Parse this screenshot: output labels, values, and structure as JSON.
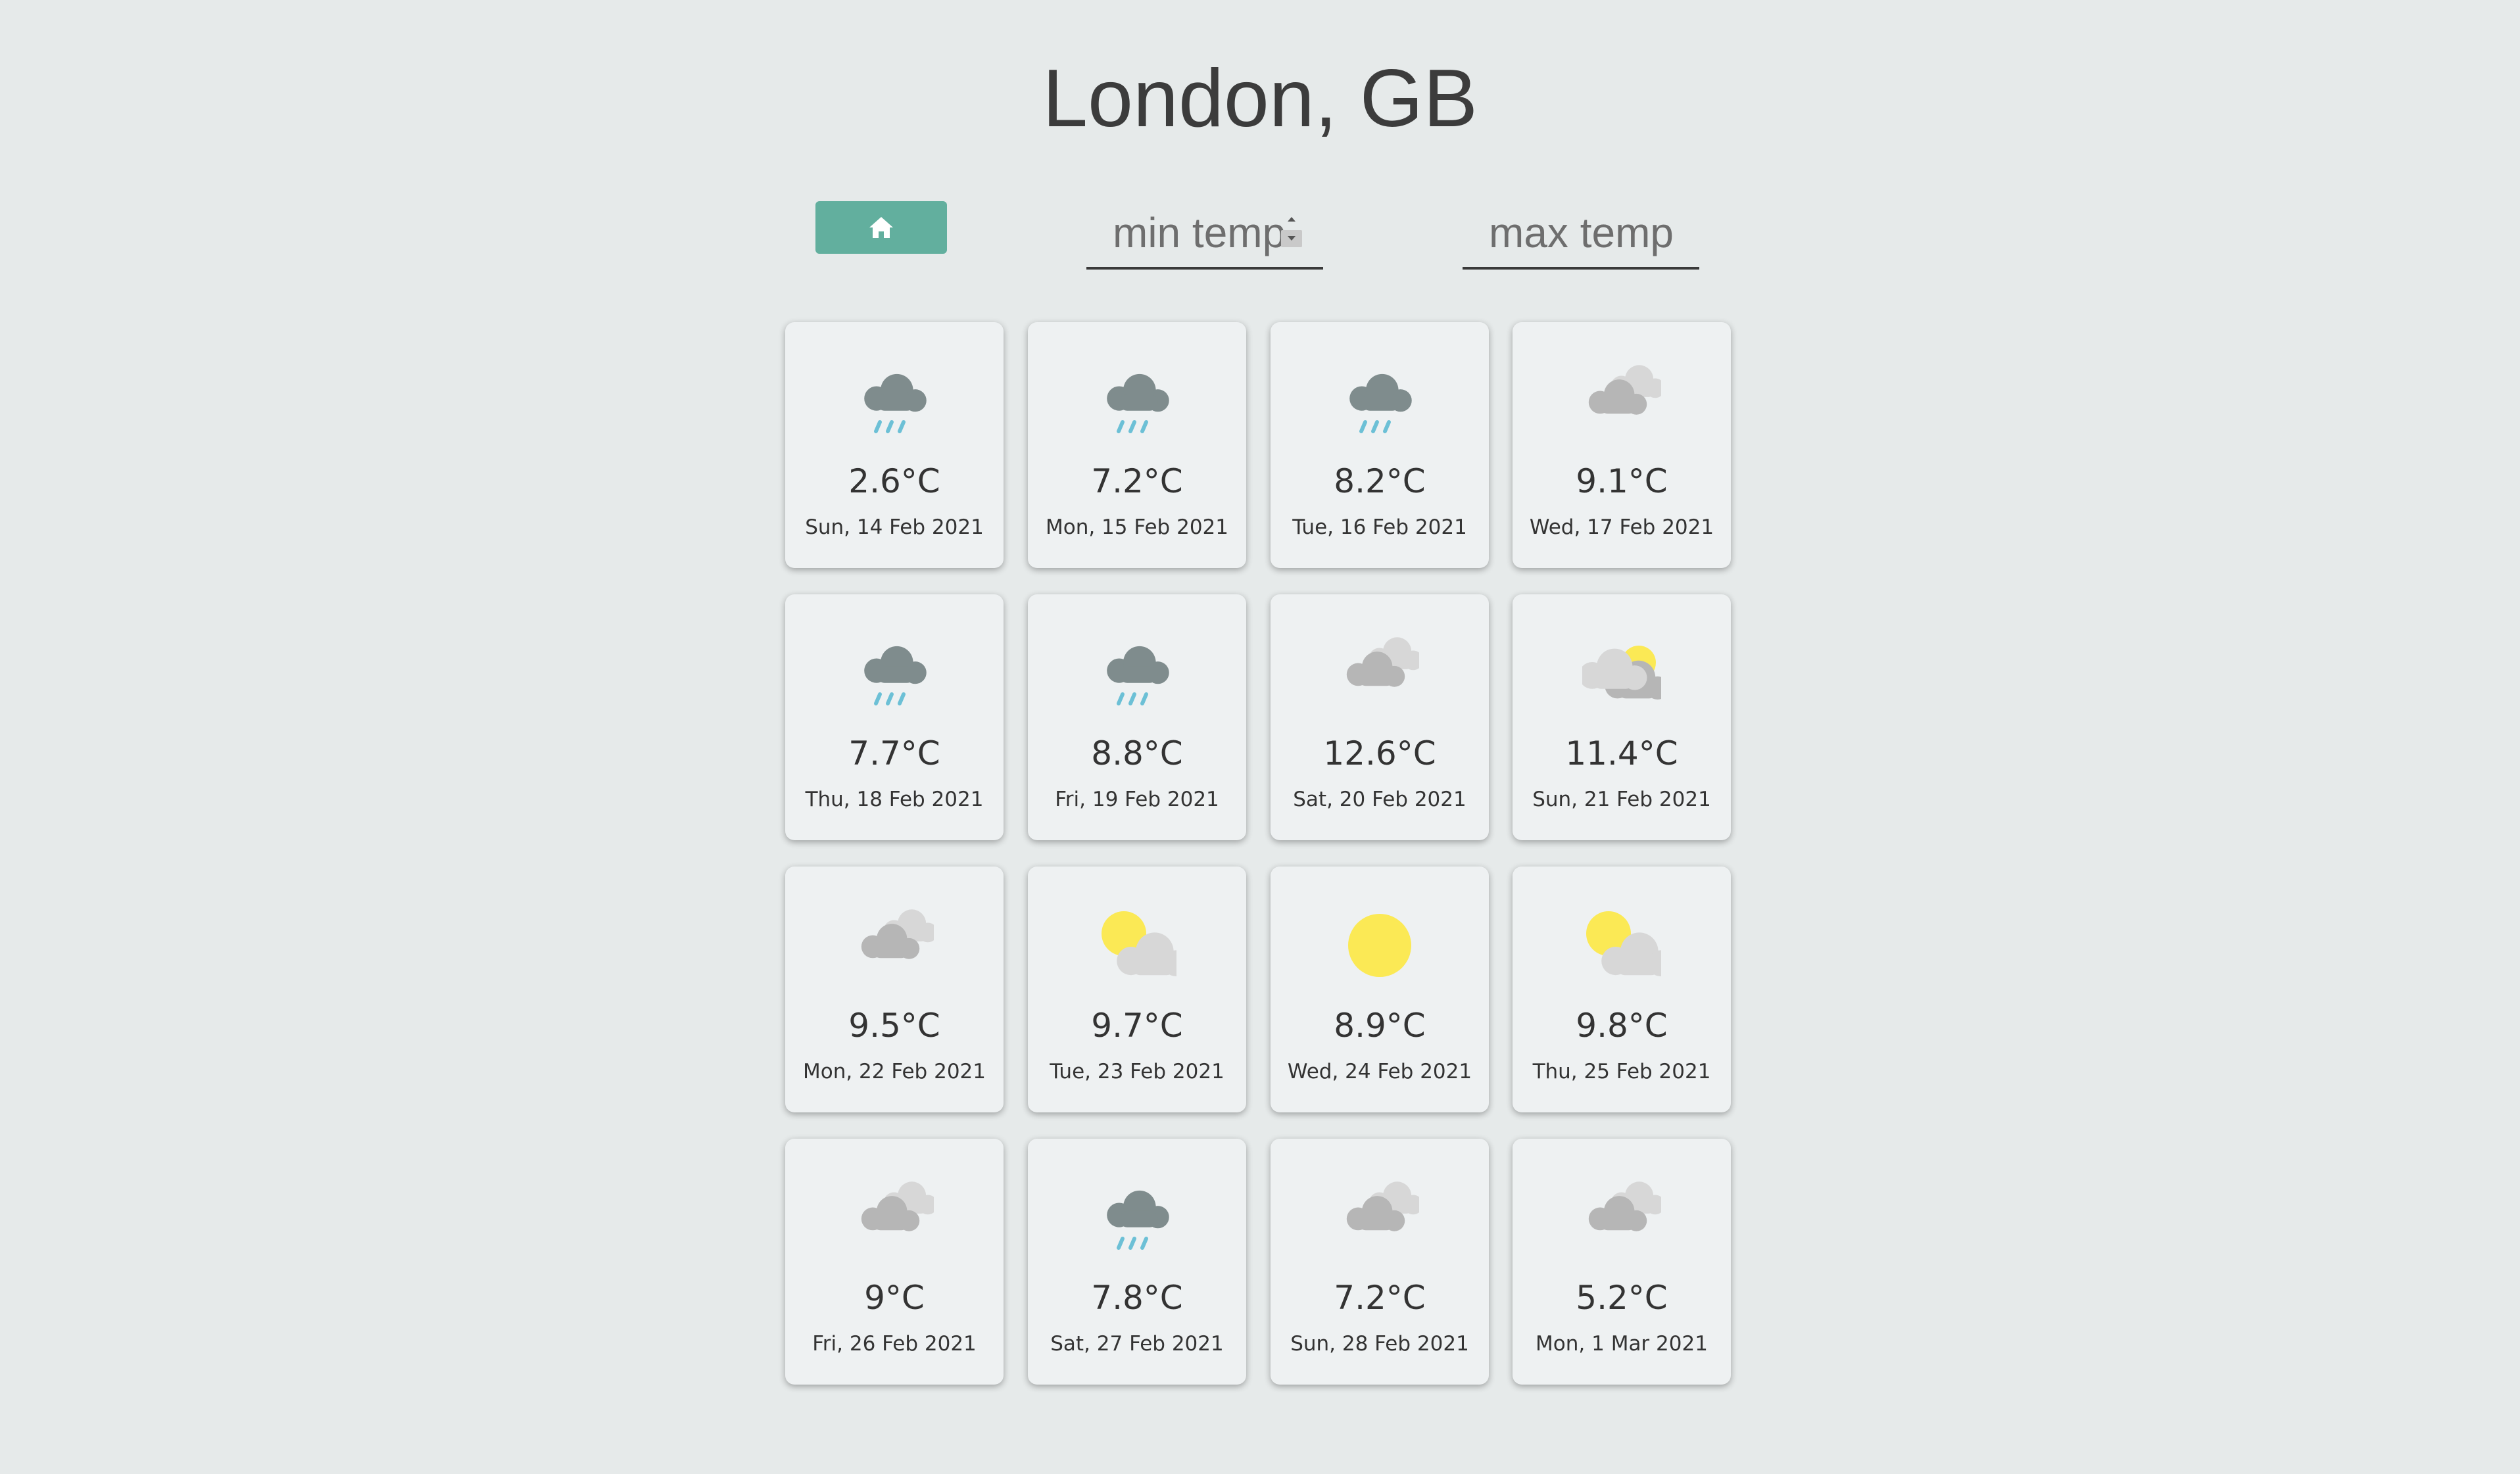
{
  "header": {
    "title": "London, GB"
  },
  "controls": {
    "min_placeholder": "min temp",
    "max_placeholder": "max temp"
  },
  "colors": {
    "home_button": "#62af9e",
    "page_background": "#e6eaea",
    "card_background": "#eef1f2",
    "rain_cloud": "#7f8c8d",
    "rain_drops": "#6cc0d6",
    "cloud_light": "#d7d7d7",
    "cloud_mid": "#b6b6b6",
    "sun": "#fbe955"
  },
  "forecast": [
    {
      "icon": "rain-icon",
      "temp": "2.6°C",
      "date": "Sun, 14 Feb 2021"
    },
    {
      "icon": "rain-icon",
      "temp": "7.2°C",
      "date": "Mon, 15 Feb 2021"
    },
    {
      "icon": "rain-icon",
      "temp": "8.2°C",
      "date": "Tue, 16 Feb 2021"
    },
    {
      "icon": "cloudy-icon",
      "temp": "9.1°C",
      "date": "Wed, 17 Feb 2021"
    },
    {
      "icon": "rain-icon",
      "temp": "7.7°C",
      "date": "Thu, 18 Feb 2021"
    },
    {
      "icon": "rain-icon",
      "temp": "8.8°C",
      "date": "Fri, 19 Feb 2021"
    },
    {
      "icon": "cloudy-icon",
      "temp": "12.6°C",
      "date": "Sat, 20 Feb 2021"
    },
    {
      "icon": "sun-behind-clouds-icon",
      "temp": "11.4°C",
      "date": "Sun, 21 Feb 2021"
    },
    {
      "icon": "cloudy-icon",
      "temp": "9.5°C",
      "date": "Mon, 22 Feb 2021"
    },
    {
      "icon": "partly-cloudy-icon",
      "temp": "9.7°C",
      "date": "Tue, 23 Feb 2021"
    },
    {
      "icon": "sun-icon",
      "temp": "8.9°C",
      "date": "Wed, 24 Feb 2021"
    },
    {
      "icon": "partly-cloudy-icon",
      "temp": "9.8°C",
      "date": "Thu, 25 Feb 2021"
    },
    {
      "icon": "cloudy-icon",
      "temp": "9°C",
      "date": "Fri, 26 Feb 2021"
    },
    {
      "icon": "rain-icon",
      "temp": "7.8°C",
      "date": "Sat, 27 Feb 2021"
    },
    {
      "icon": "cloudy-icon",
      "temp": "7.2°C",
      "date": "Sun, 28 Feb 2021"
    },
    {
      "icon": "cloudy-icon",
      "temp": "5.2°C",
      "date": "Mon, 1 Mar 2021"
    }
  ]
}
